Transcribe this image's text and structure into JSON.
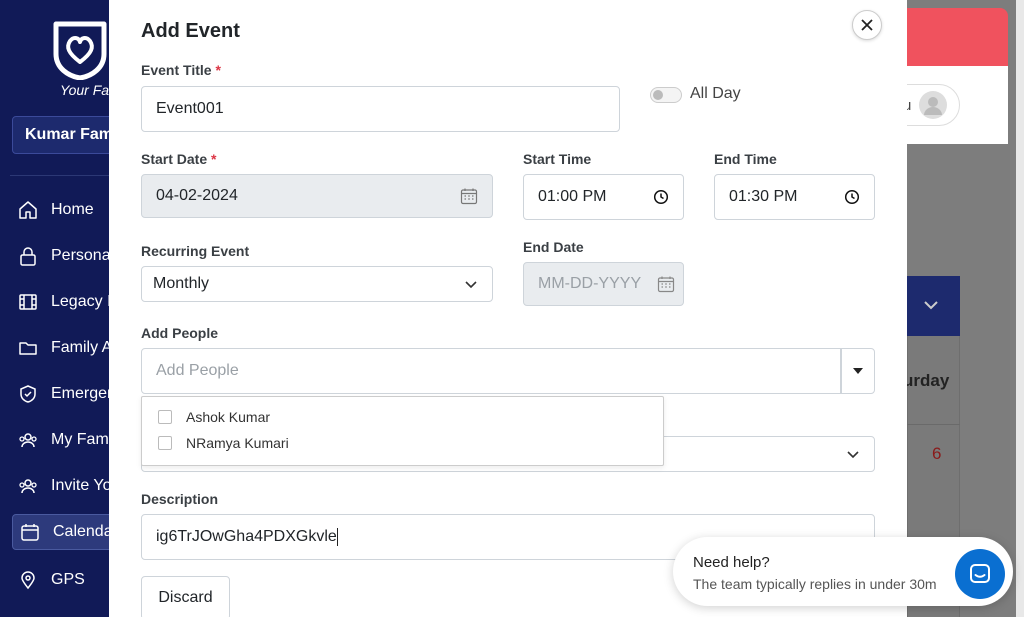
{
  "app": {
    "brand_tagline": "Your Fa",
    "family_selector": "Kumar Fami",
    "nav": [
      {
        "label": "Home",
        "icon": "home-icon"
      },
      {
        "label": "Persona",
        "icon": "lock-icon"
      },
      {
        "label": "Legacy I",
        "icon": "film-icon"
      },
      {
        "label": "Family A",
        "icon": "folder-icon"
      },
      {
        "label": "Emergen",
        "icon": "shield-check-icon"
      },
      {
        "label": "My Fam",
        "icon": "users-icon"
      },
      {
        "label": "Invite Yo",
        "icon": "users-plus-icon"
      },
      {
        "label": "Calenda",
        "icon": "calendar-icon",
        "active": true
      },
      {
        "label": "GPS",
        "icon": "location-pin-icon"
      }
    ],
    "user_initial": "u",
    "calendar_day": "urday",
    "calendar_date": "6"
  },
  "modal": {
    "title": "Add Event",
    "event_title_label": "Event Title",
    "event_title_value": "Event001",
    "all_day_label": "All Day",
    "start_date_label": "Start Date",
    "start_date_value": "04-02-2024",
    "start_time_label": "Start Time",
    "start_time_value": "01:00 PM",
    "end_time_label": "End Time",
    "end_time_value": "01:30 PM",
    "recurring_label": "Recurring Event",
    "recurring_value": "Monthly",
    "end_date_label": "End Date",
    "end_date_placeholder": "MM-DD-YYYY",
    "add_people_label": "Add People",
    "add_people_placeholder": "Add People",
    "people_options": [
      "Ashok Kumar",
      "NRamya Kumari"
    ],
    "description_label": "Description",
    "description_value": "ig6TrJOwGha4PDXGkvle",
    "discard_label": "Discard",
    "required_mark": "*"
  },
  "help_widget": {
    "title": "Need help?",
    "subtitle": "The team typically replies in under 30m"
  },
  "colors": {
    "sidebar": "#111a57",
    "header_red": "#f0525e",
    "chat_blue": "#0a6fd1",
    "required": "#dc3545"
  }
}
